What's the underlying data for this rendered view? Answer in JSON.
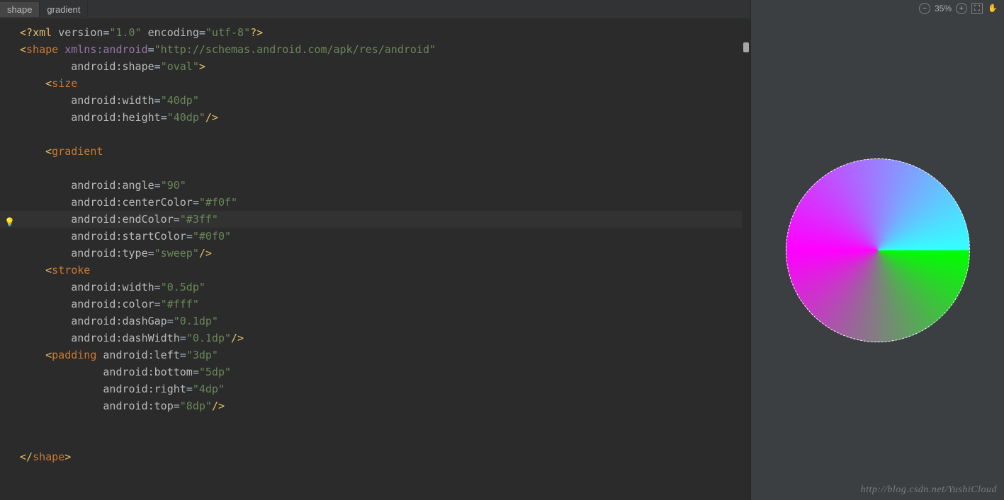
{
  "breadcrumbs": [
    "shape",
    "gradient"
  ],
  "toolbar": {
    "zoom_label": "35%"
  },
  "watermark": "http://blog.csdn.net/YushiCloud",
  "code": {
    "xml_decl": {
      "open": "<?",
      "name": "xml",
      "version_attr": "version",
      "version_val": "\"1.0\"",
      "enc_attr": "encoding",
      "enc_val": "\"utf-8\"",
      "close": "?>"
    },
    "shape_open": {
      "ns_attr": "xmlns:android",
      "ns_val": "\"http://schemas.android.com/apk/res/android\"",
      "tag": "shape"
    },
    "shape_attr": {
      "name": "android:shape",
      "val": "\"oval\""
    },
    "size": {
      "tag": "size",
      "width_name": "android:width",
      "width_val": "\"40dp\"",
      "height_name": "android:height",
      "height_val": "\"40dp\""
    },
    "gradient": {
      "tag": "gradient",
      "angle_name": "android:angle",
      "angle_val": "\"90\"",
      "center_name": "android:centerColor",
      "center_val": "\"#f0f\"",
      "end_name": "android:endColor",
      "end_val": "\"#3ff\"",
      "start_name": "android:startColor",
      "start_val": "\"#0f0\"",
      "type_name": "android:type",
      "type_val": "\"sweep\""
    },
    "stroke": {
      "tag": "stroke",
      "width_name": "android:width",
      "width_val": "\"0.5dp\"",
      "color_name": "android:color",
      "color_val": "\"#fff\"",
      "gap_name": "android:dashGap",
      "gap_val": "\"0.1dp\"",
      "dw_name": "android:dashWidth",
      "dw_val": "\"0.1dp\""
    },
    "padding": {
      "tag": "padding",
      "left_name": "android:left",
      "left_val": "\"3dp\"",
      "bottom_name": "android:bottom",
      "bottom_val": "\"5dp\"",
      "right_name": "android:right",
      "right_val": "\"4dp\"",
      "top_name": "android:top",
      "top_val": "\"8dp\""
    },
    "shape_close": {
      "tag": "shape"
    }
  }
}
